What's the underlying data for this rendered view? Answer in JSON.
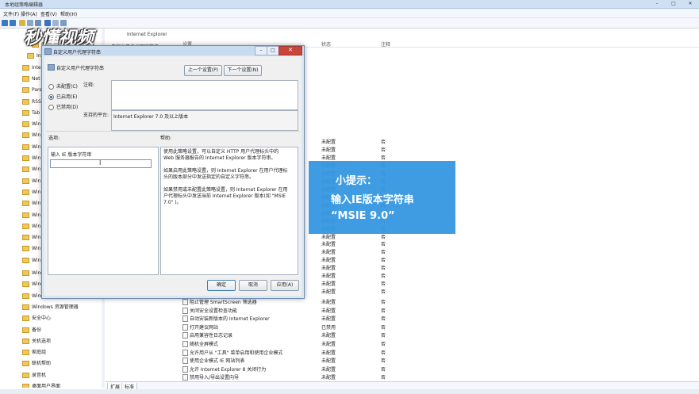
{
  "window": {
    "title": "本地组策略编辑器",
    "min": "–",
    "max": "□",
    "close": "✕"
  },
  "menu": [
    "文件(F)",
    "操作(A)",
    "查看(V)",
    "帮助(H)"
  ],
  "logo": {
    "text": "秒懂视频"
  },
  "path_title": "Internet Explorer",
  "left_panel_label": "自定义用户代理字符串",
  "columns": {
    "setting": "设置",
    "state": "状态",
    "comment": "注释"
  },
  "tree": [
    {
      "label": "Brit",
      "indent": 2
    },
    {
      "label": "Inte",
      "indent": 1
    },
    {
      "label": "Inte",
      "indent": 0
    },
    {
      "label": "Net",
      "indent": 0
    },
    {
      "label": "Pare",
      "indent": 0
    },
    {
      "label": "RSS",
      "indent": 0
    },
    {
      "label": "Tab",
      "indent": 0
    },
    {
      "label": "Win",
      "indent": 0
    },
    {
      "label": "Win",
      "indent": 0
    },
    {
      "label": "Win",
      "indent": 0
    },
    {
      "label": "Win",
      "indent": 0
    },
    {
      "label": "Win",
      "indent": 0
    },
    {
      "label": "Win",
      "indent": 0
    },
    {
      "label": "Win",
      "indent": 0
    },
    {
      "label": "Win",
      "indent": 0
    },
    {
      "label": "Win",
      "indent": 0
    },
    {
      "label": "Win",
      "indent": 0
    },
    {
      "label": "Win",
      "indent": 0
    },
    {
      "label": "Win",
      "indent": 0
    },
    {
      "label": "Win",
      "indent": 0
    },
    {
      "label": "Windows 移动中心",
      "indent": 0
    },
    {
      "label": "Windows 远程管理 (WinRM)",
      "indent": 0
    },
    {
      "label": "Windows 远程解释器",
      "indent": 0
    },
    {
      "label": "Windows 资源管理器",
      "indent": 0
    },
    {
      "label": "安全中心",
      "indent": 0
    },
    {
      "label": "备份",
      "indent": 0
    },
    {
      "label": "关机选项",
      "indent": 0
    },
    {
      "label": "家庭组",
      "indent": 0
    },
    {
      "label": "联机帮助",
      "indent": 0
    },
    {
      "label": "录音机",
      "indent": 0
    },
    {
      "label": "桌面用户界面",
      "indent": 0
    }
  ],
  "status_rows": [
    {
      "state": "未配置",
      "comment": "否"
    },
    {
      "state": "未配置",
      "comment": "否"
    },
    {
      "state": "未配置",
      "comment": "否"
    },
    {
      "state": "未配置",
      "comment": "否"
    },
    {
      "state": "未配置",
      "comment": "否"
    },
    {
      "state": "未配置",
      "comment": "否"
    },
    {
      "state": "未配置",
      "comment": "否"
    },
    {
      "state": "未配置",
      "comment": "否"
    },
    {
      "state": "未配置",
      "comment": "否"
    },
    {
      "state": "未配置",
      "comment": "否"
    },
    {
      "state": "未配置",
      "comment": "否"
    },
    {
      "state": "未配置",
      "comment": "否"
    },
    {
      "state": "未配置",
      "comment": "否"
    },
    {
      "state": "未配置",
      "comment": "否"
    },
    {
      "state": "未配置",
      "comment": "否"
    },
    {
      "state": "未配置",
      "comment": "否"
    },
    {
      "state": "未配置",
      "comment": "否"
    },
    {
      "state": "未配置",
      "comment": "否"
    },
    {
      "state": "未配置",
      "comment": "否"
    },
    {
      "state": "未配置",
      "comment": "否"
    }
  ],
  "list_rows": [
    {
      "name": "阻止管理 SmartScreen 筛选器",
      "state": "未配置",
      "comment": "否"
    },
    {
      "name": "关闭安全设置检查功能",
      "state": "未配置",
      "comment": "否"
    },
    {
      "name": "自动安装新版本的 Internet Explorer",
      "state": "未配置",
      "comment": "否"
    },
    {
      "name": "打开建议网站",
      "state": "已禁用",
      "comment": "否"
    },
    {
      "name": "启用兼容性日志记录",
      "state": "未配置",
      "comment": "否"
    },
    {
      "name": "随机全屏模式",
      "state": "未配置",
      "comment": "否"
    },
    {
      "name": "允许用户从 \"工具\" 菜单启用和使用企业模式",
      "state": "未配置",
      "comment": "否"
    },
    {
      "name": "使用企业模式 IE 网站列表",
      "state": "未配置",
      "comment": "否"
    },
    {
      "name": "允许 Internet Explorer 8 关闭行为",
      "state": "未配置",
      "comment": "否"
    },
    {
      "name": "禁用导入/导出设置向导",
      "state": "未配置",
      "comment": "否"
    }
  ],
  "tabs": [
    "扩展",
    "标准"
  ],
  "dialog": {
    "title": "自定义用户代理字符串",
    "heading": "自定义用户代理字符串",
    "prev_button": "上一个设置(P)",
    "next_button": "下一个设置(N)",
    "radio_not_configured": "未配置(C)",
    "radio_enabled": "已启用(E)",
    "radio_disabled": "已禁用(D)",
    "comment_label": "注释:",
    "supported_label": "支持的平台:",
    "supported_value": "Internet Explorer 7.0 及以上版本",
    "options_label": "选项:",
    "help_label": "帮助:",
    "option_field_label": "输入 IE 版本字符串",
    "option_field_value": "",
    "help_p1": "使用此策略设置，可以自定义 HTTP 用户代理标头中的 Web 服务器报告的 Internet Explorer 版本字符串。",
    "help_p2": "如果启用此策略设置，则 Internet Explorer 在用户代理标头的版本部分中发送指定的自定义字符串。",
    "help_p3": "如果禁用或未配置此策略设置，则 Internet Explorer 在用户代理标头中发送当前 Internet Explorer 版本(如 \"MSIE 7.0\" )。",
    "ok": "确定",
    "cancel": "取消",
    "apply": "应用(A)"
  },
  "hint": {
    "line1": "小提示：",
    "line2": "输入IE版本字符串",
    "line3": "“MSIE 9.0”"
  }
}
